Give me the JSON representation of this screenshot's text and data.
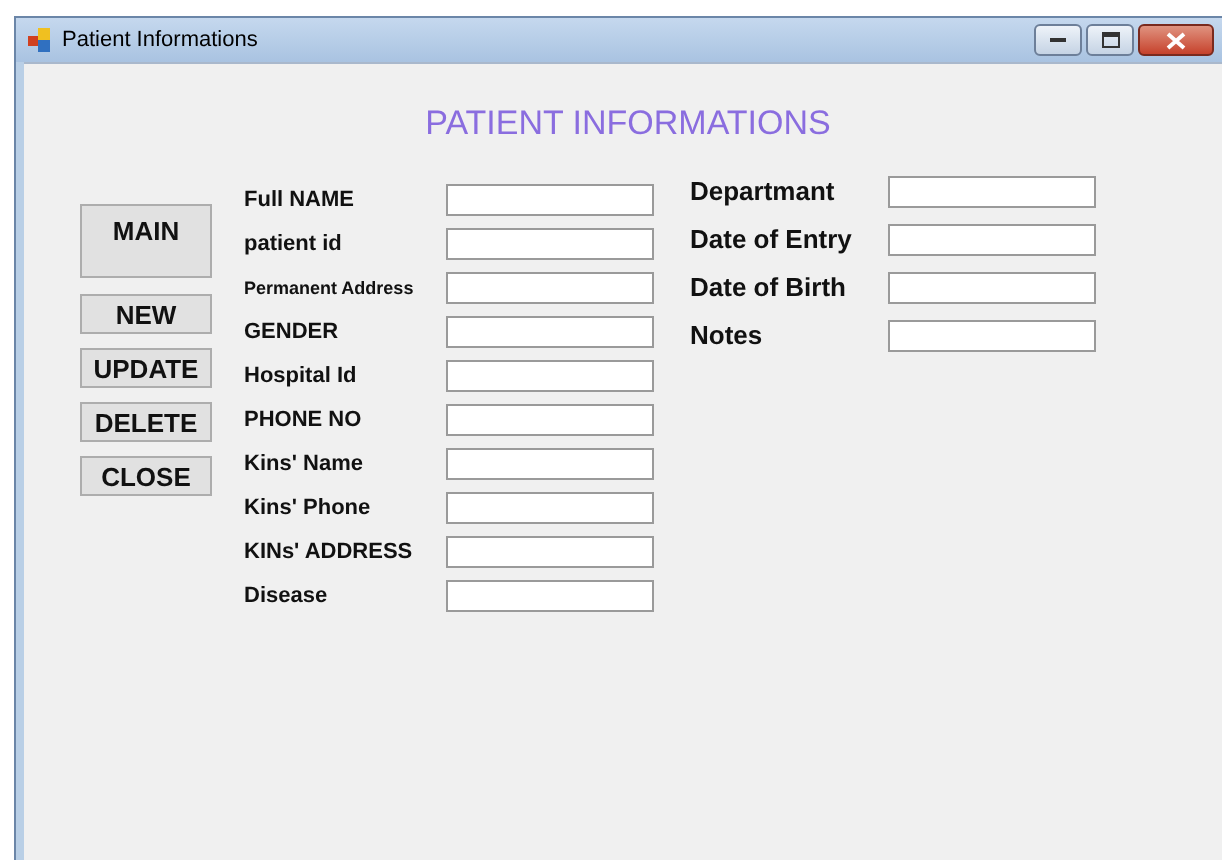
{
  "window": {
    "title": "Patient Informations"
  },
  "heading": "PATIENT INFORMATIONS",
  "buttons": [
    {
      "label": "MAIN",
      "kind": "large"
    },
    {
      "label": "NEW",
      "kind": "normal"
    },
    {
      "label": "UPDATE",
      "kind": "normal"
    },
    {
      "label": "DELETE",
      "kind": "normal"
    },
    {
      "label": "CLOSE",
      "kind": "normal"
    }
  ],
  "fields": [
    {
      "label": "Full NAME"
    },
    {
      "label": "patient id"
    },
    {
      "label": "Permanent Address"
    },
    {
      "label": "GENDER"
    },
    {
      "label": "Hospital Id"
    },
    {
      "label": "PHONE NO"
    },
    {
      "label": "Kins' Name"
    },
    {
      "label": "Kins' Phone"
    },
    {
      "label": "KINs' ADDRESS"
    },
    {
      "label": "Disease"
    }
  ],
  "side_fields": [
    {
      "label": "Departmant"
    },
    {
      "label": "Date of Entry"
    },
    {
      "label": "Date of Birth"
    },
    {
      "label": "Notes"
    }
  ]
}
